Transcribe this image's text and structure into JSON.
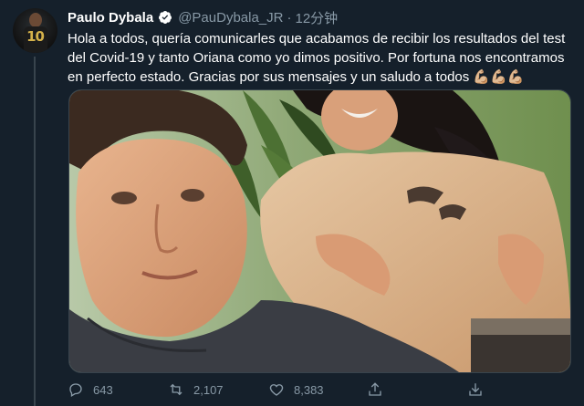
{
  "tweet": {
    "author_name": "Paulo Dybala",
    "handle": "@PauDybala_JR",
    "separator": "·",
    "time": "12分钟",
    "text": "Hola a todos, quería comunicarles que acabamos de recibir los resultados del test del Covid-19 y tanto Oriana como yo dimos positivo. Por fortuna nos encontramos en perfecto estado. Gracias por sus mensajes y un saludo a todos 💪🏼💪🏼💪🏼",
    "avatar_number": "10"
  },
  "actions": {
    "reply_count": "643",
    "retweet_count": "2,107",
    "like_count": "8,383"
  },
  "icons": {
    "verified": "verified-badge-icon",
    "reply": "reply-icon",
    "retweet": "retweet-icon",
    "like": "like-icon",
    "share": "share-icon",
    "download": "download-icon"
  },
  "colors": {
    "background": "#15202b",
    "secondary_text": "#8899a6",
    "verified": "#1da1f2"
  }
}
